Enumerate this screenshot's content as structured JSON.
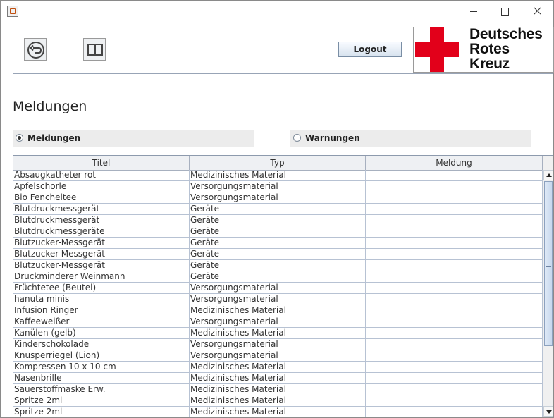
{
  "window": {
    "title": "",
    "controls": [
      "minimize",
      "maximize",
      "close"
    ]
  },
  "toolbar": {
    "back_icon": "undo-circle-icon",
    "manual_icon": "open-book-icon",
    "logout_label": "Logout"
  },
  "logo": {
    "line1": "Deutsches",
    "line2": "Rotes",
    "line3": "Kreuz",
    "cross_color": "#e2001a"
  },
  "page": {
    "title": "Meldungen"
  },
  "filters": {
    "meldungen_label": "Meldungen",
    "meldungen_selected": true,
    "warnungen_label": "Warnungen",
    "warnungen_selected": false
  },
  "table": {
    "columns": [
      "Titel",
      "Typ",
      "Meldung"
    ],
    "rows": [
      {
        "titel": "Absaugkatheter rot",
        "typ": "Medizinisches Material",
        "meldung": ""
      },
      {
        "titel": "Apfelschorle",
        "typ": "Versorgungsmaterial",
        "meldung": ""
      },
      {
        "titel": "Bio Fencheltee",
        "typ": "Versorgungsmaterial",
        "meldung": ""
      },
      {
        "titel": "Blutdruckmessgerät",
        "typ": "Geräte",
        "meldung": ""
      },
      {
        "titel": "Blutdruckmessgerät",
        "typ": "Geräte",
        "meldung": ""
      },
      {
        "titel": "Blutdruckmessgeräte",
        "typ": "Geräte",
        "meldung": ""
      },
      {
        "titel": "Blutzucker-Messgerät",
        "typ": "Geräte",
        "meldung": ""
      },
      {
        "titel": "Blutzucker-Messgerät",
        "typ": "Geräte",
        "meldung": ""
      },
      {
        "titel": "Blutzucker-Messgerät",
        "typ": "Geräte",
        "meldung": ""
      },
      {
        "titel": "Druckminderer Weinmann",
        "typ": "Geräte",
        "meldung": ""
      },
      {
        "titel": "Früchtetee (Beutel)",
        "typ": "Versorgungsmaterial",
        "meldung": ""
      },
      {
        "titel": "hanuta minis",
        "typ": "Versorgungsmaterial",
        "meldung": ""
      },
      {
        "titel": "Infusion Ringer",
        "typ": "Medizinisches Material",
        "meldung": ""
      },
      {
        "titel": "Kaffeeweißer",
        "typ": "Versorgungsmaterial",
        "meldung": ""
      },
      {
        "titel": "Kanülen (gelb)",
        "typ": "Medizinisches Material",
        "meldung": ""
      },
      {
        "titel": "Kinderschokolade",
        "typ": "Versorgungsmaterial",
        "meldung": ""
      },
      {
        "titel": "Knusperriegel (Lion)",
        "typ": "Versorgungsmaterial",
        "meldung": ""
      },
      {
        "titel": "Kompressen 10 x 10 cm",
        "typ": "Medizinisches Material",
        "meldung": ""
      },
      {
        "titel": "Nasenbrille",
        "typ": "Medizinisches Material",
        "meldung": ""
      },
      {
        "titel": "Sauerstoffmaske Erw.",
        "typ": "Medizinisches Material",
        "meldung": ""
      },
      {
        "titel": "Spritze 2ml",
        "typ": "Medizinisches Material",
        "meldung": ""
      },
      {
        "titel": "Spritze 2ml",
        "typ": "Medizinisches Material",
        "meldung": ""
      }
    ]
  }
}
